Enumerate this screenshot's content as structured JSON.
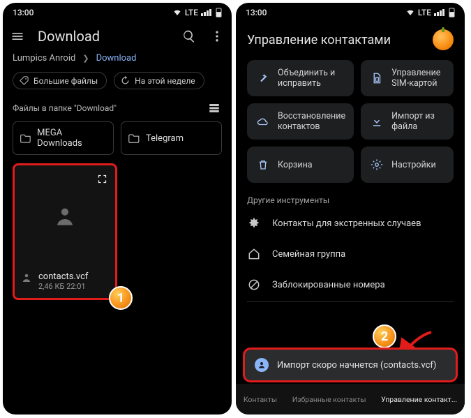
{
  "status": {
    "time": "13:00",
    "net": "LTE"
  },
  "left": {
    "title": "Download",
    "crumb_root": "Lumpics Anroid",
    "crumb_leaf": "Download",
    "chip_big": "Большие файлы",
    "chip_week": "На этой неделе",
    "section": "Файлы в папке \"Download\"",
    "folder1": "MEGA Downloads",
    "folder2": "Telegram",
    "file_name": "contacts.vcf",
    "file_info": "2,46 КБ 22:01",
    "badge": "1"
  },
  "right": {
    "title": "Управление контактами",
    "tile_merge": "Объединить и исправить",
    "tile_sim": "Управление SIM-картой",
    "tile_restore": "Восстановление контактов",
    "tile_import": "Импорт из файла",
    "tile_trash": "Корзина",
    "tile_settings": "Настройки",
    "other": "Другие инструменты",
    "item_emerg": "Контакты для экстренных случаев",
    "item_family": "Семейная группа",
    "item_blocked": "Заблокированные номера",
    "badge": "2",
    "toast": "Импорт скоро начнется (contacts.vcf)",
    "tab_contacts": "Контакты",
    "tab_fav": "Избранные контакты",
    "tab_manage": "Управление контакт..."
  }
}
